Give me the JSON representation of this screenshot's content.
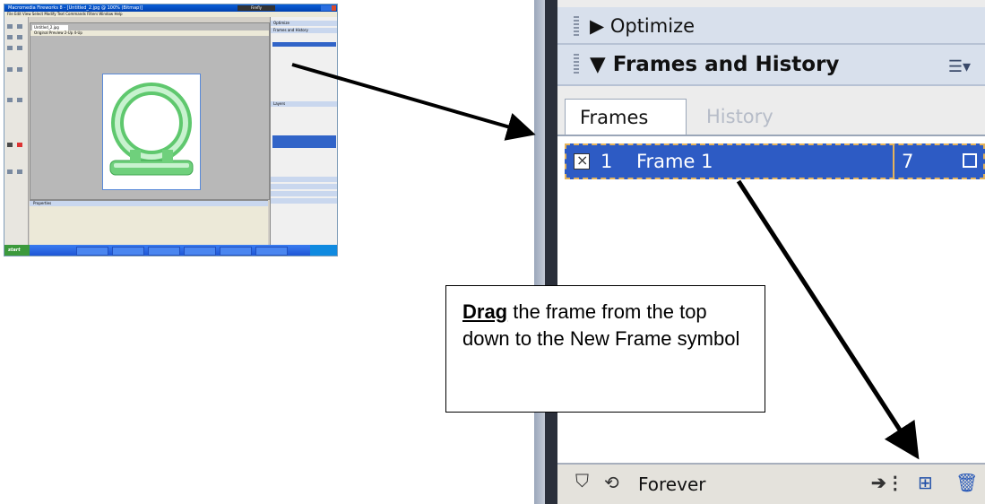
{
  "thumbnail": {
    "window_title": "Macromedia Fireworks 8 - [Untitled_2.jpg @ 100% (Bitmap)]",
    "finder_label": "Firefly",
    "menu": "File  Edit  View  Select  Modify  Text  Commands  Filters  Window  Help",
    "doc_tab": "Untitled_2.jpg",
    "doc_views": "Original  Preview  2-Up  4-Up",
    "panel_headers": [
      "Optimize",
      "Frames and History",
      "Layers"
    ],
    "properties_header": "Properties",
    "start_label": "start"
  },
  "panel": {
    "optimize_label": "Optimize",
    "frames_history_label": "Frames and History",
    "tab_frames": "Frames",
    "tab_history": "History",
    "frame_row": {
      "number": "1",
      "name": "Frame 1",
      "delay": "7"
    },
    "loop_label": "Forever"
  },
  "callout": {
    "drag_word": "Drag",
    "instruction": " the frame from the top down to the New Frame symbol"
  },
  "icons": [
    "triangle-right-icon",
    "triangle-down-icon",
    "options-menu-icon",
    "frame-check-icon",
    "onion-skin-icon",
    "loop-icon",
    "distribute-icon",
    "new-frame-icon",
    "trash-icon",
    "arrow-icon"
  ]
}
